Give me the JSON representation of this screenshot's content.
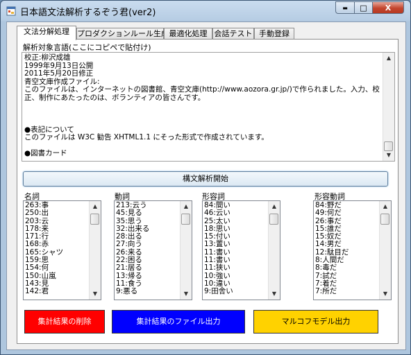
{
  "window": {
    "title": "日本語文法解析するぞう君(ver2)",
    "minimize_glyph": "▬",
    "maximize_glyph": "□",
    "close_glyph": "X"
  },
  "tabs": [
    {
      "label": "文法分解処理",
      "active": true
    },
    {
      "label": "プロダクションルール生成"
    },
    {
      "label": "最適化処理"
    },
    {
      "label": "会話テスト"
    },
    {
      "label": "手動登録"
    }
  ],
  "input": {
    "label": "解析対象言語(ここにコピペで貼付け)",
    "text": "校正:柳沢成雄\n1999年9月13日公開\n2011年5月20日修正\n青空文庫作成ファイル:\nこのファイルは、インターネットの図書館、青空文庫(http://www.aozora.gr.jp/)で作られました。入力、校正、制作にあたったのは、ボランティアの皆さんです。\n\n\n\n●表記について\nこのファイルは W3C 勧告 XHTML1.1 にそった形式で作成されています。\n\n●図書カード"
  },
  "parse_button": "構文解析開始",
  "lists": [
    {
      "label": "名詞",
      "items": [
        "263:事",
        "250:出",
        "203:云",
        "178:来",
        "171:行",
        "168:赤",
        "165:シャツ",
        "159:思",
        "154:何",
        "150:山嵐",
        "143:見",
        "142:君"
      ]
    },
    {
      "label": "動詞",
      "items": [
        "213:云う",
        "45:見る",
        "35:思う",
        "32:出来る",
        "28:出る",
        "27:向う",
        "26:来る",
        "22:困る",
        "21:居る",
        "13:帰る",
        "11:食う",
        "9:悪る"
      ]
    },
    {
      "label": "形容詞",
      "items": [
        "84:間い",
        "46:云い",
        "25:太い",
        "18:思い",
        "15:付い",
        "13:置い",
        "11:書い",
        "11:書い",
        "11:狭い",
        "10:強い",
        "10:違い",
        "9:田舎い"
      ]
    },
    {
      "label": "形容動詞",
      "items": [
        "84:野だ",
        "49:何だ",
        "26:事だ",
        "15:誰だ",
        "15:奴だ",
        "14:男だ",
        "12:駄目だ",
        "8:人間だ",
        "8:毒だ",
        "7:試だ",
        "7:着だ",
        "7:所だ"
      ]
    }
  ],
  "actions": {
    "delete": "集計結果の削除",
    "export": "集計結果のファイル出力",
    "markov": "マルコフモデル出力"
  },
  "colors": {
    "delete_bg": "#ff0000",
    "export_bg": "#0000ff",
    "markov_bg": "#ffd200"
  }
}
